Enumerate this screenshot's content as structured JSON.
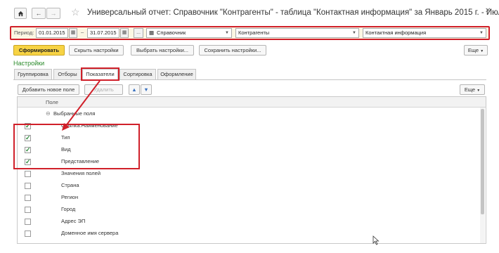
{
  "window": {
    "title": "Универсальный отчет: Справочник \"Контрагенты\" - таблица \"Контактная информация\" за Январь 2015 г. - Июл...",
    "home_icon": "home-icon",
    "star_icon": "star-icon",
    "close_icon": "close-icon"
  },
  "params": {
    "period_label": "Период:",
    "date_from": "01.01.2015",
    "date_to": "31.07.2015",
    "dash": "–",
    "ellipsis": "...",
    "source_type": "Справочник",
    "source_name": "Контрагенты",
    "table_name": "Контактная информация"
  },
  "toolbar": {
    "generate": "Сформировать",
    "hide_settings": "Скрыть настройки",
    "choose_settings": "Выбрать настройки...",
    "save_settings": "Сохранить настройки...",
    "more": "Еще"
  },
  "settings_title": "Настройки",
  "tabs": [
    {
      "label": "Группировка"
    },
    {
      "label": "Отборы"
    },
    {
      "label": "Показатели"
    },
    {
      "label": "Сортировка"
    },
    {
      "label": "Оформление"
    }
  ],
  "inner_toolbar": {
    "add_field": "Добавить новое поле",
    "delete": "Удалить",
    "more": "Еще"
  },
  "grid": {
    "header": "Поле",
    "group_label": "Выбранные поля",
    "rows": [
      {
        "label": "Ссылка.Наименование",
        "checked": true
      },
      {
        "label": "Тип",
        "checked": true
      },
      {
        "label": "Вид",
        "checked": true
      },
      {
        "label": "Представление",
        "checked": true
      },
      {
        "label": "Значения полей",
        "checked": false
      },
      {
        "label": "Страна",
        "checked": false
      },
      {
        "label": "Регион",
        "checked": false
      },
      {
        "label": "Город",
        "checked": false
      },
      {
        "label": "Адрес ЭП",
        "checked": false
      },
      {
        "label": "Доменное имя сервера",
        "checked": false
      }
    ]
  },
  "colors": {
    "highlight": "#d0202a",
    "accent_green": "#2a8a2a",
    "primary_button": "#f7d344"
  }
}
